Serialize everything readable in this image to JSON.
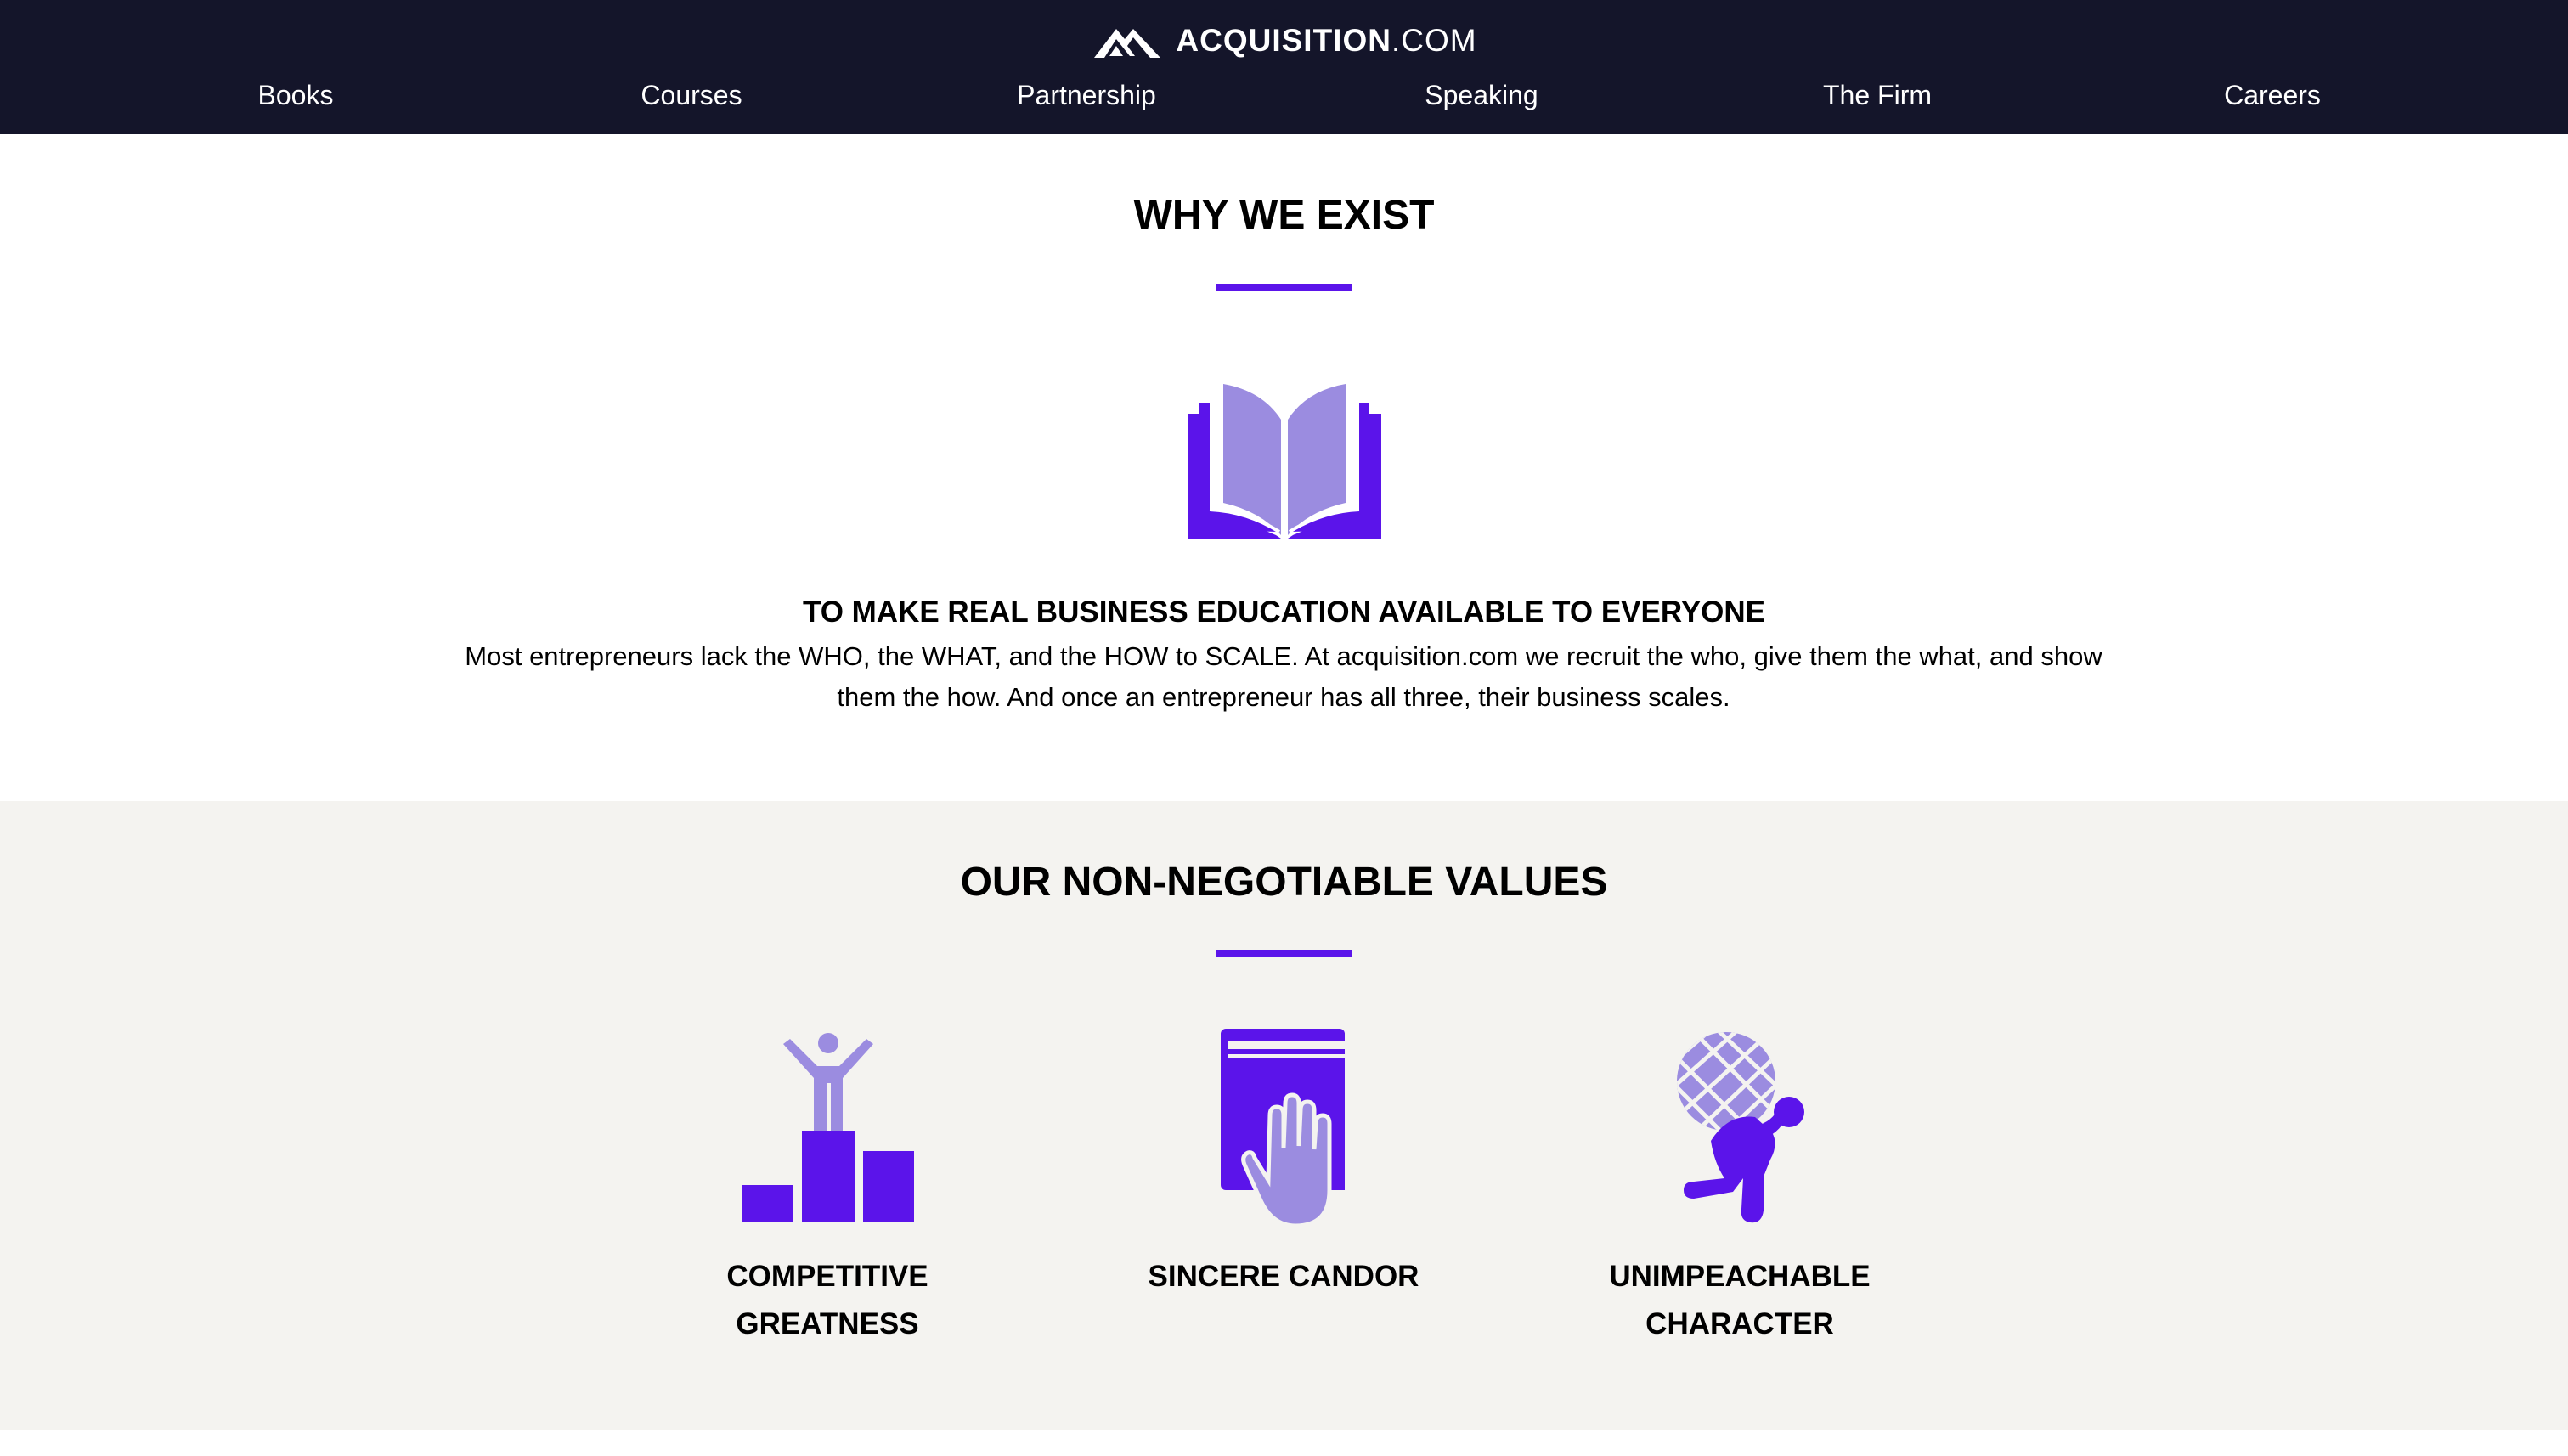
{
  "header": {
    "logo_bold": "ACQUISITION",
    "logo_light": ".COM",
    "logo_icon": "mountain-logo-icon",
    "nav": [
      {
        "label": "Books"
      },
      {
        "label": "Courses"
      },
      {
        "label": "Partnership"
      },
      {
        "label": "Speaking"
      },
      {
        "label": "The Firm"
      },
      {
        "label": "Careers"
      }
    ]
  },
  "why": {
    "heading": "WHY WE EXIST",
    "icon": "open-book-icon",
    "mission_title": "TO MAKE REAL BUSINESS EDUCATION AVAILABLE TO EVERYONE",
    "mission_body": "Most entrepreneurs lack the WHO, the WHAT, and the HOW to SCALE. At acquisition.com we recruit the who, give them the what, and show them the how. And once an entrepreneur has all three, their business scales."
  },
  "values": {
    "heading": "OUR NON-NEGOTIABLE VALUES",
    "items": [
      {
        "icon": "podium-winner-icon",
        "line1": "COMPETITIVE",
        "line2": "GREATNESS"
      },
      {
        "icon": "hand-on-book-icon",
        "line1": "SINCERE CANDOR",
        "line2": ""
      },
      {
        "icon": "atlas-globe-icon",
        "line1": "UNIMPEACHABLE",
        "line2": "CHARACTER"
      }
    ]
  },
  "colors": {
    "header_bg": "#14152a",
    "accent": "#5b14ea",
    "accent_light": "#9b8ce0",
    "values_bg": "#f4f3f0"
  }
}
